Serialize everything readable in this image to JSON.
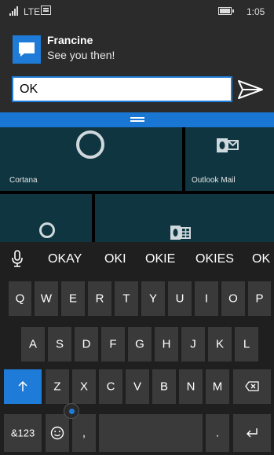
{
  "status": {
    "network": "LTE",
    "time": "1:05"
  },
  "notification": {
    "sender": "Francine",
    "message": "See you then!",
    "reply_value": "OK",
    "reply_placeholder": ""
  },
  "tiles": [
    {
      "label": "Cortana"
    },
    {
      "label": "Outlook Mail"
    }
  ],
  "suggestions": [
    "OKAY",
    "OKI",
    "OKIE",
    "OKIES",
    "OK"
  ],
  "keyboard": {
    "row1": [
      "Q",
      "W",
      "E",
      "R",
      "T",
      "Y",
      "U",
      "I",
      "O",
      "P"
    ],
    "row2": [
      "A",
      "S",
      "D",
      "F",
      "G",
      "H",
      "J",
      "K",
      "L"
    ],
    "row3": [
      "Z",
      "X",
      "C",
      "V",
      "B",
      "N",
      "M"
    ],
    "numbers_label": "&123",
    "comma": ",",
    "period": "."
  },
  "colors": {
    "accent": "#1e7bd7",
    "grip": "#1976d2",
    "key": "#3a3a3a",
    "tile": "#0e3540"
  },
  "icons": [
    "signal-icon",
    "message-icon",
    "battery-icon",
    "chat-icon",
    "send-icon",
    "microphone-icon",
    "shift-icon",
    "backspace-icon",
    "emoji-icon",
    "enter-icon",
    "cortana-icon",
    "outlook-icon"
  ]
}
